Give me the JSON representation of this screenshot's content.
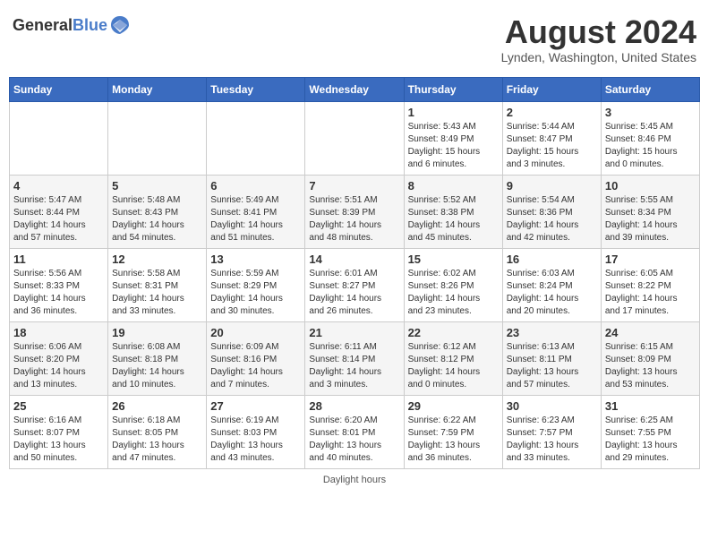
{
  "header": {
    "logo_general": "General",
    "logo_blue": "Blue",
    "month_title": "August 2024",
    "location": "Lynden, Washington, United States"
  },
  "days_of_week": [
    "Sunday",
    "Monday",
    "Tuesday",
    "Wednesday",
    "Thursday",
    "Friday",
    "Saturday"
  ],
  "footer": {
    "note": "Daylight hours"
  },
  "weeks": [
    [
      {
        "day": "",
        "info": ""
      },
      {
        "day": "",
        "info": ""
      },
      {
        "day": "",
        "info": ""
      },
      {
        "day": "",
        "info": ""
      },
      {
        "day": "1",
        "info": "Sunrise: 5:43 AM\nSunset: 8:49 PM\nDaylight: 15 hours\nand 6 minutes."
      },
      {
        "day": "2",
        "info": "Sunrise: 5:44 AM\nSunset: 8:47 PM\nDaylight: 15 hours\nand 3 minutes."
      },
      {
        "day": "3",
        "info": "Sunrise: 5:45 AM\nSunset: 8:46 PM\nDaylight: 15 hours\nand 0 minutes."
      }
    ],
    [
      {
        "day": "4",
        "info": "Sunrise: 5:47 AM\nSunset: 8:44 PM\nDaylight: 14 hours\nand 57 minutes."
      },
      {
        "day": "5",
        "info": "Sunrise: 5:48 AM\nSunset: 8:43 PM\nDaylight: 14 hours\nand 54 minutes."
      },
      {
        "day": "6",
        "info": "Sunrise: 5:49 AM\nSunset: 8:41 PM\nDaylight: 14 hours\nand 51 minutes."
      },
      {
        "day": "7",
        "info": "Sunrise: 5:51 AM\nSunset: 8:39 PM\nDaylight: 14 hours\nand 48 minutes."
      },
      {
        "day": "8",
        "info": "Sunrise: 5:52 AM\nSunset: 8:38 PM\nDaylight: 14 hours\nand 45 minutes."
      },
      {
        "day": "9",
        "info": "Sunrise: 5:54 AM\nSunset: 8:36 PM\nDaylight: 14 hours\nand 42 minutes."
      },
      {
        "day": "10",
        "info": "Sunrise: 5:55 AM\nSunset: 8:34 PM\nDaylight: 14 hours\nand 39 minutes."
      }
    ],
    [
      {
        "day": "11",
        "info": "Sunrise: 5:56 AM\nSunset: 8:33 PM\nDaylight: 14 hours\nand 36 minutes."
      },
      {
        "day": "12",
        "info": "Sunrise: 5:58 AM\nSunset: 8:31 PM\nDaylight: 14 hours\nand 33 minutes."
      },
      {
        "day": "13",
        "info": "Sunrise: 5:59 AM\nSunset: 8:29 PM\nDaylight: 14 hours\nand 30 minutes."
      },
      {
        "day": "14",
        "info": "Sunrise: 6:01 AM\nSunset: 8:27 PM\nDaylight: 14 hours\nand 26 minutes."
      },
      {
        "day": "15",
        "info": "Sunrise: 6:02 AM\nSunset: 8:26 PM\nDaylight: 14 hours\nand 23 minutes."
      },
      {
        "day": "16",
        "info": "Sunrise: 6:03 AM\nSunset: 8:24 PM\nDaylight: 14 hours\nand 20 minutes."
      },
      {
        "day": "17",
        "info": "Sunrise: 6:05 AM\nSunset: 8:22 PM\nDaylight: 14 hours\nand 17 minutes."
      }
    ],
    [
      {
        "day": "18",
        "info": "Sunrise: 6:06 AM\nSunset: 8:20 PM\nDaylight: 14 hours\nand 13 minutes."
      },
      {
        "day": "19",
        "info": "Sunrise: 6:08 AM\nSunset: 8:18 PM\nDaylight: 14 hours\nand 10 minutes."
      },
      {
        "day": "20",
        "info": "Sunrise: 6:09 AM\nSunset: 8:16 PM\nDaylight: 14 hours\nand 7 minutes."
      },
      {
        "day": "21",
        "info": "Sunrise: 6:11 AM\nSunset: 8:14 PM\nDaylight: 14 hours\nand 3 minutes."
      },
      {
        "day": "22",
        "info": "Sunrise: 6:12 AM\nSunset: 8:12 PM\nDaylight: 14 hours\nand 0 minutes."
      },
      {
        "day": "23",
        "info": "Sunrise: 6:13 AM\nSunset: 8:11 PM\nDaylight: 13 hours\nand 57 minutes."
      },
      {
        "day": "24",
        "info": "Sunrise: 6:15 AM\nSunset: 8:09 PM\nDaylight: 13 hours\nand 53 minutes."
      }
    ],
    [
      {
        "day": "25",
        "info": "Sunrise: 6:16 AM\nSunset: 8:07 PM\nDaylight: 13 hours\nand 50 minutes."
      },
      {
        "day": "26",
        "info": "Sunrise: 6:18 AM\nSunset: 8:05 PM\nDaylight: 13 hours\nand 47 minutes."
      },
      {
        "day": "27",
        "info": "Sunrise: 6:19 AM\nSunset: 8:03 PM\nDaylight: 13 hours\nand 43 minutes."
      },
      {
        "day": "28",
        "info": "Sunrise: 6:20 AM\nSunset: 8:01 PM\nDaylight: 13 hours\nand 40 minutes."
      },
      {
        "day": "29",
        "info": "Sunrise: 6:22 AM\nSunset: 7:59 PM\nDaylight: 13 hours\nand 36 minutes."
      },
      {
        "day": "30",
        "info": "Sunrise: 6:23 AM\nSunset: 7:57 PM\nDaylight: 13 hours\nand 33 minutes."
      },
      {
        "day": "31",
        "info": "Sunrise: 6:25 AM\nSunset: 7:55 PM\nDaylight: 13 hours\nand 29 minutes."
      }
    ]
  ]
}
